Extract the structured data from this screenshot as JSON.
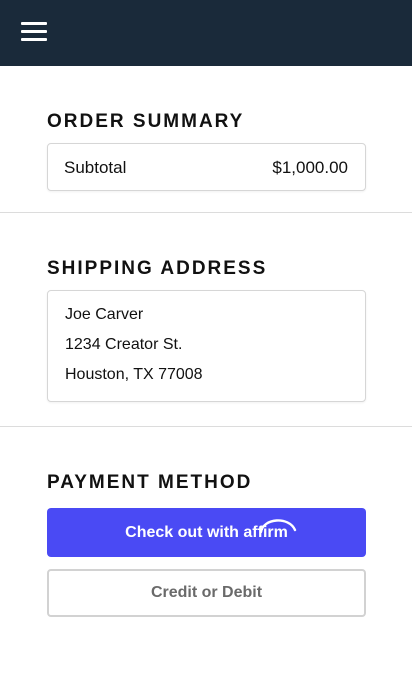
{
  "header": {
    "menu_icon": "hamburger-menu-icon",
    "background_color": "#1a2a3a"
  },
  "order_summary": {
    "title": "ORDER SUMMARY",
    "subtotal_label": "Subtotal",
    "subtotal_value": "$1,000.00"
  },
  "shipping_address": {
    "title": "SHIPPING ADDRESS",
    "lines": [
      "Joe Carver",
      "1234 Creator St.",
      "Houston, TX 77008"
    ]
  },
  "payment_method": {
    "title": "PAYMENT METHOD",
    "affirm_button": {
      "prefix": "Check out with",
      "brand": "affirm",
      "color": "#4a4af4"
    },
    "credit_button_label": "Credit or Debit"
  }
}
